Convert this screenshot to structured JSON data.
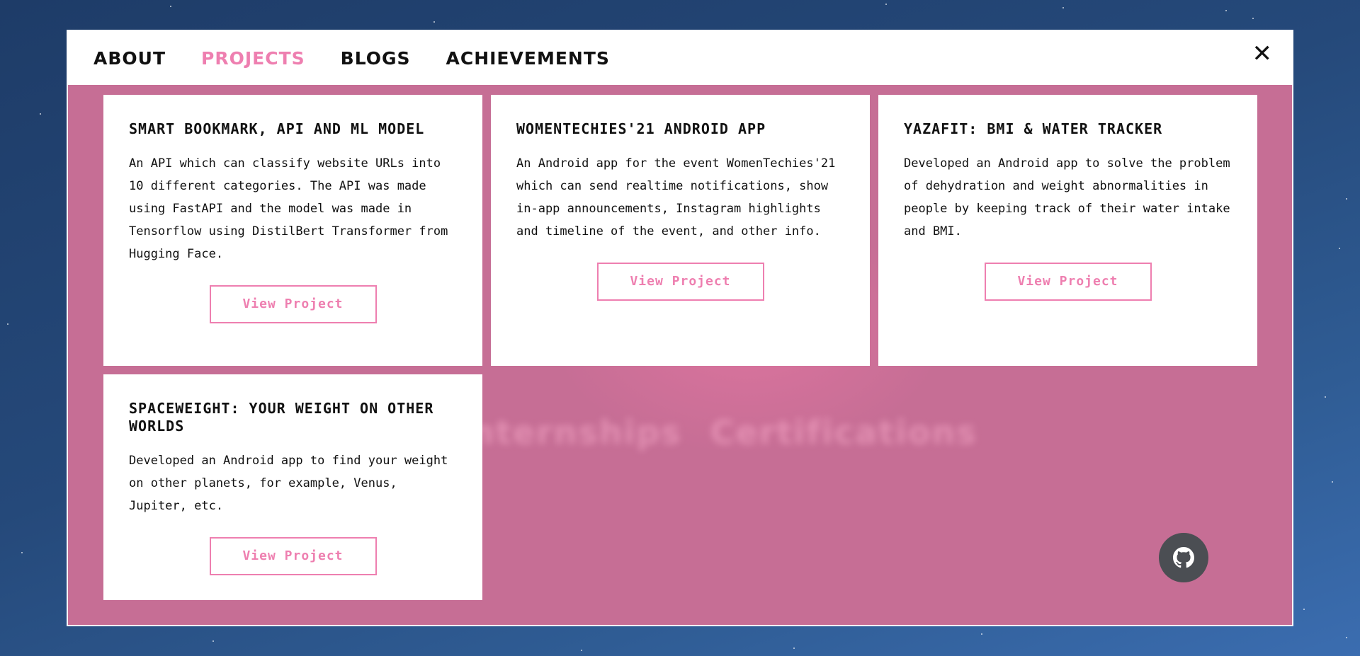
{
  "nav": {
    "items": [
      "About",
      "Projects",
      "Blogs",
      "Achievements"
    ],
    "active": "Projects",
    "close_glyph": "✕"
  },
  "background_text": [
    "Internships",
    "Certifications"
  ],
  "projects": [
    {
      "title": "Smart Bookmark, API and ML Model",
      "description": "An API which can classify website URLs into 10 different categories. The API was made using FastAPI and the model was made in Tensorflow using DistilBert Transformer from Hugging Face.",
      "button": "View Project"
    },
    {
      "title": "WomenTechies'21 Android App",
      "description": "An Android app for the event WomenTechies'21 which can send realtime notifications, show in-app announcements, Instagram highlights and timeline of the event, and other info.",
      "button": "View Project"
    },
    {
      "title": "YazaFit: BMI & Water Tracker",
      "description": "Developed an Android app to solve the problem of dehydration and weight abnormalities in people by keeping track of their water intake and BMI.",
      "button": "View Project"
    },
    {
      "title": "SpaceWeight: Your Weight on Other Worlds",
      "description": "Developed an Android app to find your weight on other planets, for example, Venus, Jupiter, etc.",
      "button": "View Project"
    }
  ],
  "fab": {
    "icon": "github-icon"
  },
  "colors": {
    "accent_pink": "#ee7fb0",
    "modal_bg": "#c66e95",
    "page_bg": "#25497a",
    "text": "#111111"
  }
}
